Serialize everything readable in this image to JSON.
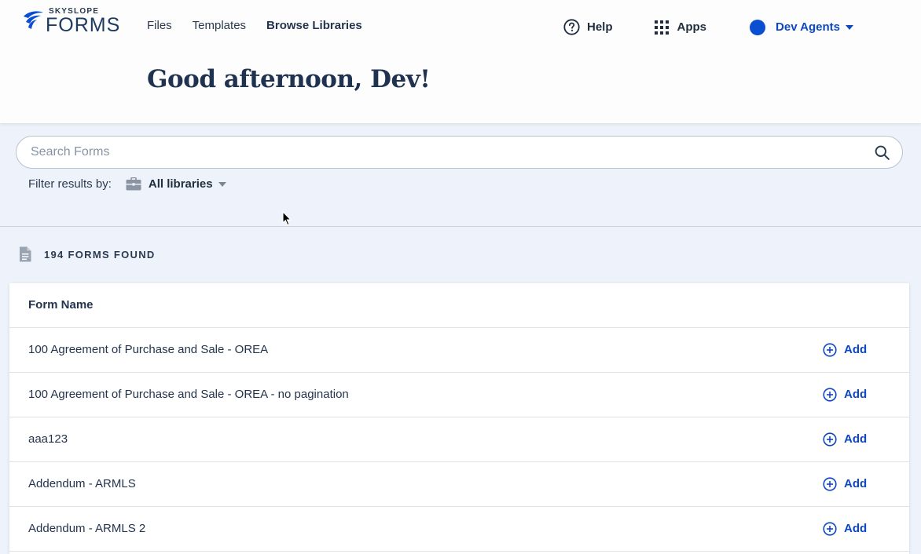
{
  "app": {
    "logo_small": "SKYSLOPE",
    "logo_big": "FORMS",
    "brand_color": "#0a4fd1"
  },
  "nav": {
    "items": [
      {
        "label": "Files"
      },
      {
        "label": "Templates"
      },
      {
        "label": "Browse Libraries",
        "active": true
      }
    ]
  },
  "header_right": {
    "help_label": "Help",
    "apps_label": "Apps",
    "account_name": "Dev Agents"
  },
  "greeting": "Good afternoon, Dev!",
  "search": {
    "placeholder": "Search Forms",
    "value": ""
  },
  "filter": {
    "label": "Filter results by:",
    "library_value": "All libraries"
  },
  "results": {
    "count_text": "194 FORMS FOUND"
  },
  "table": {
    "header": "Form Name",
    "add_label": "Add",
    "rows": [
      {
        "name": "100 Agreement of Purchase and Sale - OREA"
      },
      {
        "name": "100 Agreement of Purchase and Sale - OREA - no pagination"
      },
      {
        "name": "aaa123"
      },
      {
        "name": "Addendum - ARMLS"
      },
      {
        "name": "Addendum - ARMLS 2"
      }
    ]
  }
}
